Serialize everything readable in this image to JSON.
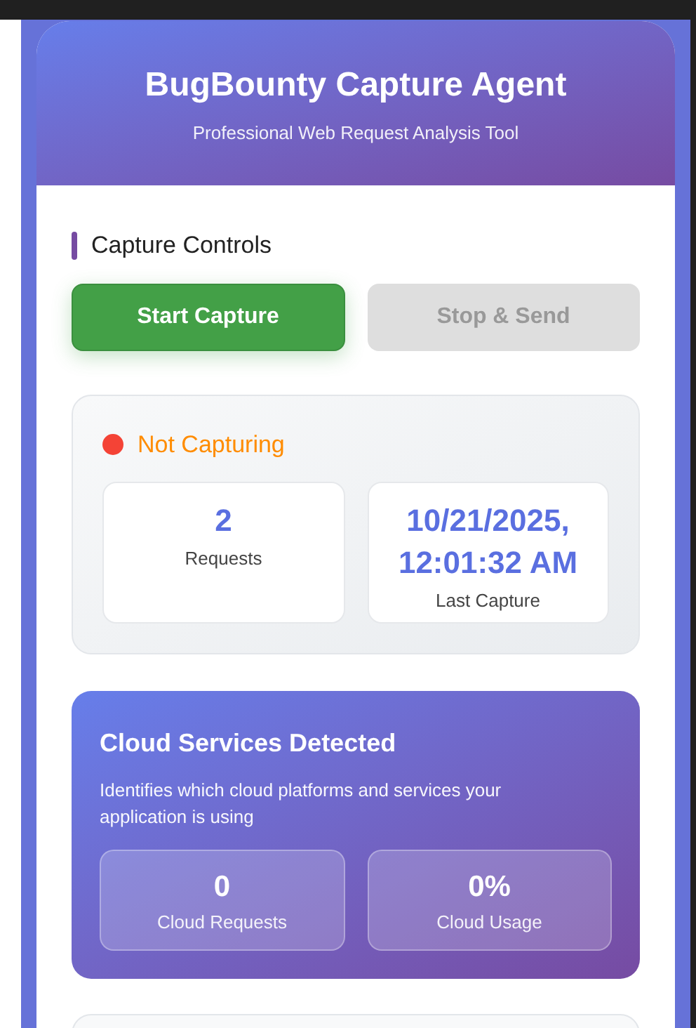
{
  "header": {
    "title": "BugBounty Capture Agent",
    "subtitle": "Professional Web Request Analysis Tool"
  },
  "controls": {
    "heading": "Capture Controls",
    "buttons": [
      {
        "label": "Start Capture",
        "kind": "primary",
        "disabled": false
      },
      {
        "label": "Stop & Send",
        "kind": "secondary",
        "disabled": true
      }
    ]
  },
  "status": {
    "label": "Not Capturing",
    "capturing": false,
    "stats": [
      {
        "value": "2",
        "label": "Requests"
      },
      {
        "value": "10/21/2025, 12:01:32 AM",
        "label": "Last Capture"
      }
    ]
  },
  "cloud": {
    "title": "Cloud Services Detected",
    "description": "Identifies which cloud platforms and services your application is using",
    "stats": [
      {
        "value": "0",
        "label": "Cloud Requests"
      },
      {
        "value": "0%",
        "label": "Cloud Usage"
      }
    ]
  }
}
